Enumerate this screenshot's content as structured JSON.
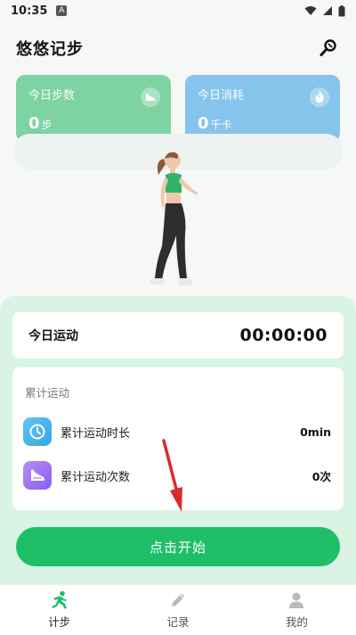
{
  "status_bar": {
    "time": "10:35",
    "notification_letter": "A"
  },
  "header": {
    "title": "悠悠记步"
  },
  "cards": {
    "steps": {
      "label": "今日步数",
      "value": "0",
      "unit": "步",
      "icon": "shoe-icon"
    },
    "calories": {
      "label": "今日消耗",
      "value": "0",
      "unit": "千卡",
      "icon": "flame-icon"
    }
  },
  "today": {
    "label": "今日运动",
    "time": "00:00:00"
  },
  "cumulative": {
    "title": "累计运动",
    "rows": [
      {
        "label": "累计运动时长",
        "value": "0min",
        "icon": "clock-icon"
      },
      {
        "label": "累计运动次数",
        "value": "0次",
        "icon": "shoe-icon"
      }
    ]
  },
  "start_button": {
    "label": "点击开始"
  },
  "tabs": [
    {
      "label": "计步",
      "icon": "runner-icon",
      "active": true
    },
    {
      "label": "记录",
      "icon": "pencil-icon",
      "active": false
    },
    {
      "label": "我的",
      "icon": "user-icon",
      "active": false
    }
  ],
  "colors": {
    "primary_green": "#1fbf6a",
    "steps_card": "#7dd3a1",
    "calories_card": "#86c4ec",
    "panel": "#d9f3e4",
    "annotation_arrow": "#d92b2b"
  }
}
